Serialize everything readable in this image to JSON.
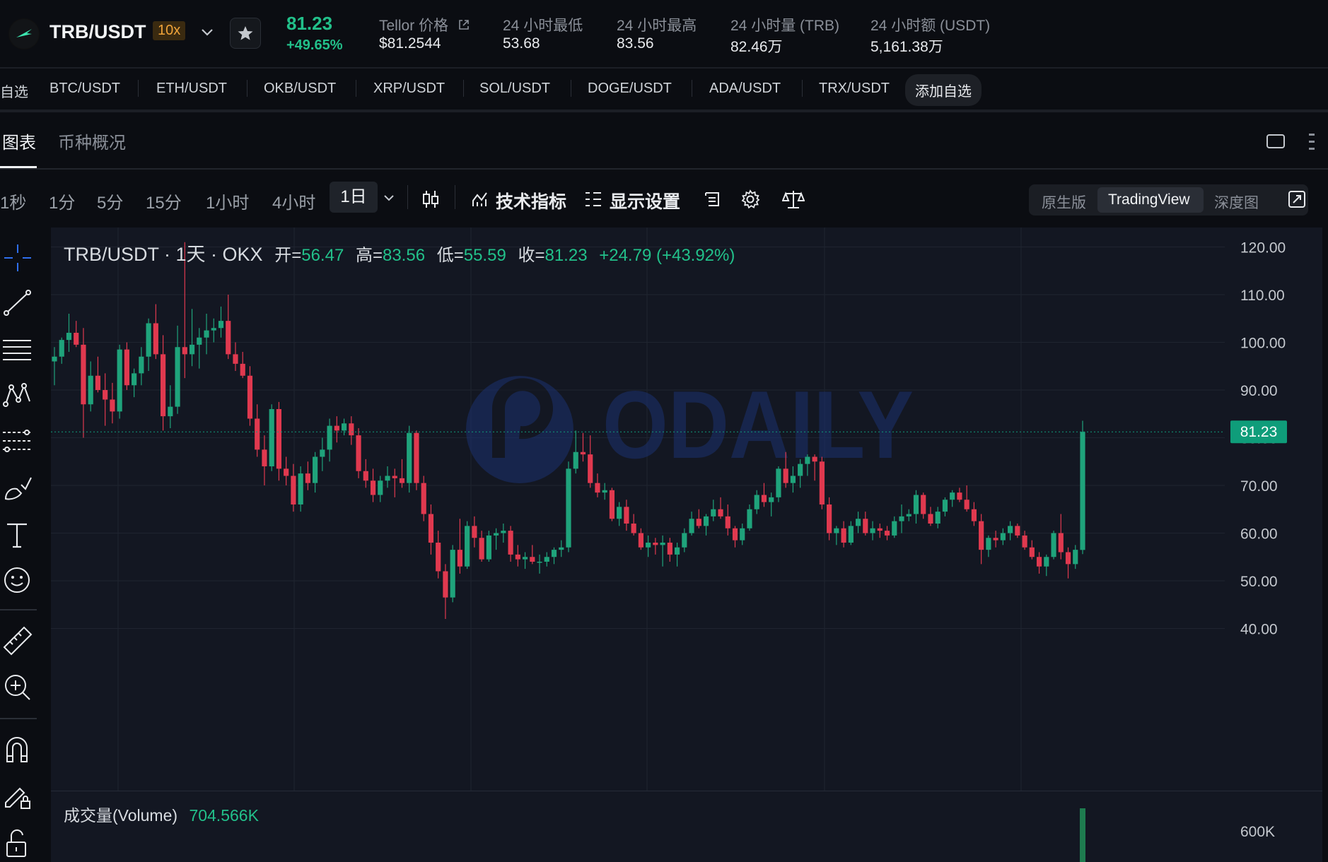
{
  "header": {
    "pair": "TRB/USDT",
    "leverage": "10x",
    "last_price": "81.23",
    "change_pct": "+49.65%",
    "stats": [
      {
        "label": "Tellor 价格",
        "value": "$81.2544"
      },
      {
        "label": "24 小时最低",
        "value": "53.68"
      },
      {
        "label": "24 小时最高",
        "value": "83.56"
      },
      {
        "label": "24 小时量 (TRB)",
        "value": "82.46万"
      },
      {
        "label": "24 小时额 (USDT)",
        "value": "5,161.38万"
      }
    ]
  },
  "favorites": {
    "label": "自选",
    "pairs": [
      "BTC/USDT",
      "ETH/USDT",
      "OKB/USDT",
      "XRP/USDT",
      "SOL/USDT",
      "DOGE/USDT",
      "ADA/USDT",
      "TRX/USDT"
    ],
    "add_label": "添加自选"
  },
  "tabs": {
    "chart": "图表",
    "overview": "币种概况"
  },
  "toolbar": {
    "timeframes": [
      "1秒",
      "1分",
      "5分",
      "15分",
      "1小时",
      "4小时"
    ],
    "active_timeframe": "1日",
    "indicators": "技术指标",
    "display_settings": "显示设置",
    "views": [
      "原生版",
      "TradingView",
      "深度图"
    ]
  },
  "legend": {
    "symbol": "TRB/USDT · 1天 · OKX",
    "open_label": "开=",
    "open": "56.47",
    "high_label": "高=",
    "high": "83.56",
    "low_label": "低=",
    "low": "55.59",
    "close_label": "收=",
    "close": "81.23",
    "change": "+24.79 (+43.92%)"
  },
  "volume_legend": {
    "label": "成交量(Volume)",
    "value": "704.566K"
  },
  "watermark": "ODAILY",
  "colors": {
    "up": "#1fa37b",
    "down": "#e0394f",
    "background": "#131722",
    "grid": "#1f2430",
    "price_tag": "#0f9d7a"
  },
  "chart_data": {
    "type": "candlestick",
    "title": "TRB/USDT · 1天 · OKX",
    "ylim": [
      35,
      130
    ],
    "yticks": [
      130,
      120,
      110,
      100,
      90,
      80,
      70,
      60,
      50,
      40
    ],
    "current_price": 81.23,
    "volume_axis_label": "600K",
    "ohlc": [
      [
        96.0,
        99.0,
        91.0,
        97.0
      ],
      [
        97.0,
        101.0,
        95.5,
        100.5
      ],
      [
        100.5,
        106.0,
        98.0,
        102.0
      ],
      [
        102.0,
        104.5,
        99.0,
        99.5
      ],
      [
        99.5,
        103.0,
        80.0,
        87.0
      ],
      [
        87.0,
        96.0,
        85.5,
        93.0
      ],
      [
        93.0,
        97.0,
        89.5,
        90.0
      ],
      [
        90.0,
        93.5,
        82.5,
        88.0
      ],
      [
        88.0,
        91.5,
        83.0,
        85.5
      ],
      [
        85.5,
        99.5,
        84.0,
        98.5
      ],
      [
        98.5,
        100.0,
        90.0,
        91.0
      ],
      [
        91.0,
        94.5,
        88.5,
        93.5
      ],
      [
        93.5,
        99.0,
        91.0,
        97.0
      ],
      [
        97.0,
        105.0,
        94.0,
        104.0
      ],
      [
        104.0,
        108.0,
        96.5,
        97.5
      ],
      [
        97.5,
        101.5,
        81.5,
        84.5
      ],
      [
        84.5,
        91.0,
        82.0,
        86.5
      ],
      [
        86.5,
        103.5,
        85.0,
        99.0
      ],
      [
        99.0,
        121.0,
        92.5,
        97.5
      ],
      [
        97.5,
        107.0,
        95.0,
        99.5
      ],
      [
        99.5,
        103.0,
        94.5,
        101.0
      ],
      [
        101.0,
        106.0,
        97.5,
        102.5
      ],
      [
        102.5,
        105.0,
        100.0,
        103.0
      ],
      [
        103.0,
        107.5,
        101.0,
        104.5
      ],
      [
        104.5,
        110.0,
        96.5,
        97.5
      ],
      [
        97.5,
        100.0,
        94.0,
        95.5
      ],
      [
        95.5,
        98.0,
        92.5,
        93.0
      ],
      [
        93.0,
        95.0,
        82.5,
        84.0
      ],
      [
        84.0,
        87.0,
        76.0,
        77.5
      ],
      [
        77.5,
        80.5,
        70.0,
        74.0
      ],
      [
        74.0,
        87.0,
        73.0,
        86.0
      ],
      [
        86.0,
        87.5,
        71.0,
        73.5
      ],
      [
        73.5,
        76.0,
        70.0,
        72.0
      ],
      [
        72.0,
        74.5,
        64.5,
        66.0
      ],
      [
        66.0,
        74.0,
        64.5,
        72.5
      ],
      [
        72.5,
        75.0,
        69.0,
        70.5
      ],
      [
        70.5,
        77.0,
        68.5,
        76.0
      ],
      [
        76.0,
        80.0,
        73.0,
        77.5
      ],
      [
        77.5,
        84.0,
        75.0,
        82.5
      ],
      [
        82.5,
        84.5,
        79.0,
        81.5
      ],
      [
        81.5,
        84.0,
        80.5,
        83.0
      ],
      [
        83.0,
        84.5,
        78.5,
        80.5
      ],
      [
        80.5,
        82.0,
        71.5,
        73.0
      ],
      [
        73.0,
        75.5,
        69.5,
        71.0
      ],
      [
        71.0,
        73.5,
        66.5,
        68.0
      ],
      [
        68.0,
        72.0,
        66.5,
        71.0
      ],
      [
        71.0,
        74.0,
        69.5,
        72.0
      ],
      [
        72.0,
        73.5,
        67.5,
        71.5
      ],
      [
        71.5,
        75.5,
        69.5,
        70.5
      ],
      [
        70.5,
        82.5,
        68.5,
        81.0
      ],
      [
        81.0,
        81.5,
        69.0,
        70.5
      ],
      [
        70.5,
        72.0,
        62.5,
        64.0
      ],
      [
        64.0,
        66.0,
        55.5,
        58.0
      ],
      [
        58.0,
        60.5,
        50.5,
        52.0
      ],
      [
        52.0,
        53.5,
        42.0,
        46.5
      ],
      [
        46.5,
        57.5,
        45.5,
        56.5
      ],
      [
        56.5,
        63.0,
        51.5,
        53.0
      ],
      [
        53.0,
        62.5,
        52.5,
        61.5
      ],
      [
        61.5,
        63.5,
        57.0,
        59.0
      ],
      [
        59.0,
        60.5,
        54.0,
        54.5
      ],
      [
        54.5,
        60.5,
        54.0,
        59.5
      ],
      [
        59.5,
        61.0,
        56.5,
        60.0
      ],
      [
        60.0,
        62.0,
        58.0,
        60.5
      ],
      [
        60.5,
        61.5,
        54.0,
        55.5
      ],
      [
        55.5,
        57.5,
        53.0,
        54.5
      ],
      [
        54.5,
        56.0,
        52.5,
        55.0
      ],
      [
        55.0,
        57.5,
        53.5,
        54.0
      ],
      [
        54.0,
        55.5,
        51.5,
        54.0
      ],
      [
        54.0,
        56.0,
        53.0,
        55.0
      ],
      [
        55.0,
        57.0,
        53.5,
        56.5
      ],
      [
        56.5,
        58.5,
        55.0,
        57.0
      ],
      [
        57.0,
        75.0,
        56.0,
        73.5
      ],
      [
        73.5,
        81.5,
        72.5,
        77.0
      ],
      [
        77.0,
        81.0,
        75.0,
        76.5
      ],
      [
        76.5,
        80.5,
        69.5,
        70.5
      ],
      [
        70.5,
        72.5,
        67.5,
        68.5
      ],
      [
        68.5,
        70.5,
        67.0,
        69.0
      ],
      [
        69.0,
        69.5,
        62.5,
        63.0
      ],
      [
        63.0,
        66.5,
        61.5,
        65.5
      ],
      [
        65.5,
        67.0,
        60.5,
        62.0
      ],
      [
        62.0,
        64.0,
        59.5,
        60.0
      ],
      [
        60.0,
        61.0,
        56.5,
        57.0
      ],
      [
        57.0,
        59.5,
        55.0,
        58.0
      ],
      [
        58.0,
        59.0,
        55.5,
        57.5
      ],
      [
        57.5,
        59.5,
        53.0,
        58.0
      ],
      [
        58.0,
        59.0,
        54.0,
        55.5
      ],
      [
        55.5,
        58.0,
        53.0,
        57.0
      ],
      [
        57.0,
        61.0,
        56.0,
        60.0
      ],
      [
        60.0,
        64.5,
        59.5,
        63.0
      ],
      [
        63.0,
        65.0,
        61.0,
        61.5
      ],
      [
        61.5,
        64.0,
        59.5,
        63.5
      ],
      [
        63.5,
        67.0,
        62.5,
        65.0
      ],
      [
        65.0,
        67.5,
        63.0,
        63.5
      ],
      [
        63.5,
        66.0,
        59.5,
        61.0
      ],
      [
        61.0,
        61.5,
        57.0,
        58.5
      ],
      [
        58.5,
        62.0,
        57.5,
        61.0
      ],
      [
        61.0,
        66.0,
        60.5,
        65.0
      ],
      [
        65.0,
        69.0,
        64.0,
        68.0
      ],
      [
        68.0,
        70.5,
        65.5,
        66.5
      ],
      [
        66.5,
        68.5,
        63.5,
        67.5
      ],
      [
        67.5,
        74.0,
        66.5,
        73.5
      ],
      [
        73.5,
        77.0,
        69.5,
        70.5
      ],
      [
        70.5,
        74.0,
        68.5,
        72.0
      ],
      [
        72.0,
        75.5,
        69.5,
        74.5
      ],
      [
        74.5,
        76.5,
        72.0,
        76.0
      ],
      [
        76.0,
        76.5,
        71.0,
        75.0
      ],
      [
        75.0,
        76.0,
        65.0,
        66.0
      ],
      [
        66.0,
        67.5,
        58.5,
        60.0
      ],
      [
        60.0,
        61.5,
        57.5,
        61.0
      ],
      [
        61.0,
        62.5,
        57.0,
        58.0
      ],
      [
        58.0,
        62.5,
        57.5,
        61.5
      ],
      [
        61.5,
        64.5,
        60.0,
        63.0
      ],
      [
        63.0,
        64.5,
        59.5,
        60.0
      ],
      [
        60.0,
        62.5,
        58.5,
        61.0
      ],
      [
        61.0,
        62.0,
        59.0,
        60.5
      ],
      [
        60.5,
        61.5,
        58.5,
        59.5
      ],
      [
        59.5,
        63.5,
        59.0,
        62.5
      ],
      [
        62.5,
        66.0,
        60.0,
        63.5
      ],
      [
        63.5,
        65.0,
        62.5,
        64.0
      ],
      [
        64.0,
        69.0,
        62.0,
        68.0
      ],
      [
        68.0,
        68.5,
        63.0,
        64.0
      ],
      [
        64.0,
        65.5,
        61.5,
        62.0
      ],
      [
        62.0,
        65.5,
        61.0,
        64.5
      ],
      [
        64.5,
        67.5,
        63.5,
        67.0
      ],
      [
        67.0,
        69.0,
        65.5,
        68.5
      ],
      [
        68.5,
        69.5,
        66.5,
        67.0
      ],
      [
        67.0,
        70.0,
        64.5,
        65.0
      ],
      [
        65.0,
        66.5,
        61.5,
        62.5
      ],
      [
        62.5,
        64.0,
        53.5,
        56.5
      ],
      [
        56.5,
        59.5,
        55.0,
        59.0
      ],
      [
        59.0,
        60.5,
        57.0,
        58.5
      ],
      [
        58.5,
        61.0,
        57.5,
        60.0
      ],
      [
        60.0,
        62.5,
        58.5,
        61.5
      ],
      [
        61.5,
        62.0,
        59.0,
        59.5
      ],
      [
        59.5,
        60.5,
        56.5,
        57.0
      ],
      [
        57.0,
        58.5,
        54.5,
        55.0
      ],
      [
        55.0,
        56.0,
        51.5,
        53.0
      ],
      [
        53.0,
        55.5,
        51.0,
        55.0
      ],
      [
        55.0,
        60.5,
        54.5,
        60.0
      ],
      [
        60.0,
        64.0,
        54.5,
        56.0
      ],
      [
        56.0,
        57.0,
        50.5,
        53.5
      ],
      [
        53.5,
        57.5,
        52.5,
        56.5
      ],
      [
        56.47,
        83.56,
        55.59,
        81.23
      ]
    ]
  }
}
